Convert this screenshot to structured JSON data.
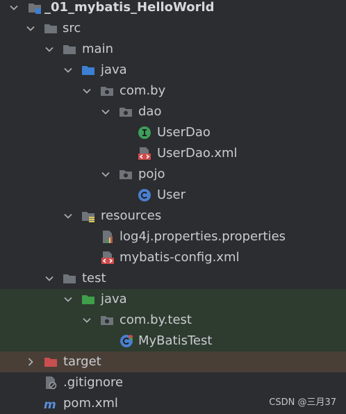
{
  "project_tree": {
    "items": [
      {
        "label": "_01_mybatis_HelloWorld",
        "icon": "project-module-icon",
        "expanded": true
      },
      {
        "label": "src",
        "icon": "folder-icon",
        "expanded": true
      },
      {
        "label": "main",
        "icon": "folder-icon",
        "expanded": true
      },
      {
        "label": "java",
        "icon": "source-root-folder-icon",
        "expanded": true
      },
      {
        "label": "com.by",
        "icon": "package-icon",
        "expanded": true
      },
      {
        "label": "dao",
        "icon": "package-icon",
        "expanded": true
      },
      {
        "label": "UserDao",
        "icon": "interface-icon"
      },
      {
        "label": "UserDao.xml",
        "icon": "xml-file-icon"
      },
      {
        "label": "pojo",
        "icon": "package-icon",
        "expanded": true
      },
      {
        "label": "User",
        "icon": "class-icon"
      },
      {
        "label": "resources",
        "icon": "resources-folder-icon",
        "expanded": true
      },
      {
        "label": "log4j.properties.properties",
        "icon": "properties-file-icon"
      },
      {
        "label": "mybatis-config.xml",
        "icon": "xml-file-icon"
      },
      {
        "label": "test",
        "icon": "folder-icon",
        "expanded": true
      },
      {
        "label": "java",
        "icon": "test-source-root-folder-icon",
        "expanded": true
      },
      {
        "label": "com.by.test",
        "icon": "package-icon",
        "expanded": true
      },
      {
        "label": "MyBatisTest",
        "icon": "test-class-icon"
      },
      {
        "label": "target",
        "icon": "excluded-folder-icon",
        "expanded": false
      },
      {
        "label": ".gitignore",
        "icon": "gitignore-file-icon"
      },
      {
        "label": "pom.xml",
        "icon": "maven-pom-icon"
      }
    ]
  },
  "watermark": "CSDN @三月37",
  "colors": {
    "background": "#2b2d30",
    "text": "#c9ccd1",
    "test_row_background": "#2e3b2f",
    "excluded_row_background": "#4a3f37",
    "source_folder": "#3d7fd2",
    "test_folder": "#3e9e4a",
    "excluded_folder": "#c94f4f",
    "interface_green": "#3e9e5a",
    "class_blue": "#4a7fd0",
    "xml_red": "#d04a4a"
  }
}
